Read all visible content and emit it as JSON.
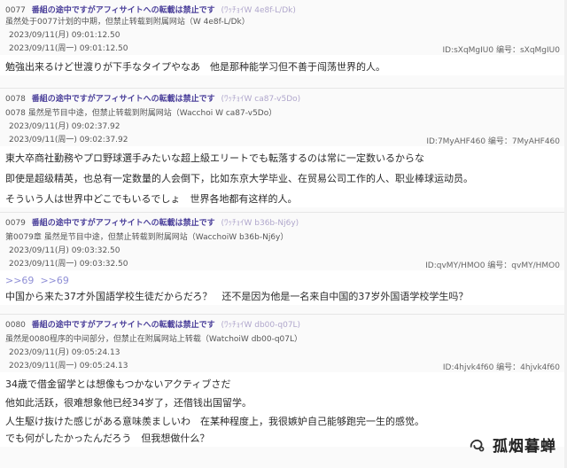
{
  "posts": [
    {
      "no": "0077",
      "title": "番組の途中ですがアフィサイトへの転載は禁止です",
      "uid": "(ﾜｯﾁｮｲW 4e8f-L/Dk)",
      "sub": "虽然处于0077计划的中期，但禁止转载到附属网站（W 4e8f-L/Dk）",
      "date_orig": "2023/09/11(月) 09:01:12.50",
      "date_cn": "2023/09/11(周一) 09:01:12.50",
      "id_text": "ID:sXqMgIU0 编号：sXqMgIU0",
      "lines": [
        "勉強出来るけど世渡りが下手なタイプやなあ　他是那种能学习但不善于闯荡世界的人。"
      ]
    },
    {
      "no": "0078",
      "title": "番組の途中ですがアフィサイトへの転載は禁止です",
      "uid": "(ﾜｯﾁｮｲW ca87-v5Do)",
      "sub": "0078 虽然是节目中途，但禁止转载到附属网站（Wacchoi W ca87-v5Do）",
      "date_orig": "2023/09/11(月) 09:02:37.92",
      "date_cn": "2023/09/11(周一) 09:02:37.92",
      "id_text": "ID:7MyAHF460 编号：7MyAHF460",
      "lines": [
        "東大卒商社勤務やプロ野球選手みたいな超上級エリートでも転落するのは常に一定数いるからな",
        "即使是超级精英，也总有一定数量的人会倒下，比如东京大学毕业、在贸易公司工作的人、职业棒球运动员。",
        "そういう人は世界中どこでもいるでしょ　世界各地都有这样的人。"
      ]
    },
    {
      "no": "0079",
      "title": "番組の途中ですがアフィサイトへの転載は禁止です",
      "uid": "(ﾜｯﾁｮｲW b36b-Nj6y)",
      "sub": "第0079章 虽然是节目中途，但禁止转载到附属网站（WacchoiW b36b-Nj6y）",
      "date_orig": "2023/09/11(月) 09:03:32.50",
      "date_cn": "2023/09/11(周一) 09:03:32.50",
      "id_text": "ID:qvMY/HMO0 编号：qvMY/HMO0",
      "link_a": ">>69",
      "link_b": ">>69",
      "lines": [
        "中国から来た37才外国語学校生徒だからだろ？　还不是因为他是一名来自中国的37岁外国语学校学生吗？"
      ]
    },
    {
      "no": "0080",
      "title": "番組の途中ですがアフィサイトへの転載は禁止です",
      "uid": "(ﾜｯﾁｮｲW db00-q07L)",
      "sub": "虽然是0080程序的中间部分，但禁止在附属网站上转载（WatchoiW db00-q07L）",
      "date_orig": "2023/09/11(月) 09:05:24.13",
      "date_cn": "2023/09/11(周一) 09:05:24.13",
      "id_text": "ID:4hjvk4f60 编号：4hjvk4f60",
      "lines": [
        "34歳で借金留学とは想像もつかないアクティブさだ",
        "他如此活跃，很难想象他已经34岁了，还借钱出国留学。",
        "人生駆け抜けた感じがある意味羨ましいわ　在某种程度上，我很嫉妒自己能够跑完一生的感觉。",
        "",
        "でも何がしたかったんだろう　但我想做什么？"
      ]
    }
  ],
  "watermark": "孤烟暮蝉"
}
